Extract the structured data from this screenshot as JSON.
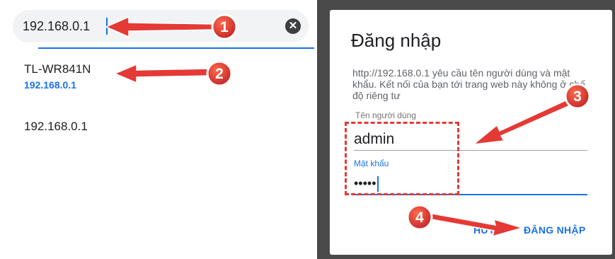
{
  "browser": {
    "url_value": "192.168.0.1",
    "clear_icon": "close-circle-icon",
    "clear_glyph": "✕",
    "suggestions": [
      {
        "title": "TL-WR841N",
        "url": "192.168.0.1"
      },
      {
        "title": "192.168.0.1"
      }
    ]
  },
  "dialog": {
    "title": "Đăng nhập",
    "message": "http://192.168.0.1 yêu cầu tên người dùng và mật khẩu. Kết nối của bạn tới trang web này không ở chế độ riêng tư",
    "username_label": "Tên người dùng",
    "username_value": "admin",
    "password_label": "Mật khẩu",
    "password_value": "•••••",
    "cancel_label": "HỦY",
    "login_label": "ĐĂNG NHẬP"
  },
  "annotations": {
    "step_numbers": [
      "1",
      "2",
      "3",
      "4"
    ],
    "marker_color": "#e53935",
    "accent_color": "#1a73e8"
  }
}
